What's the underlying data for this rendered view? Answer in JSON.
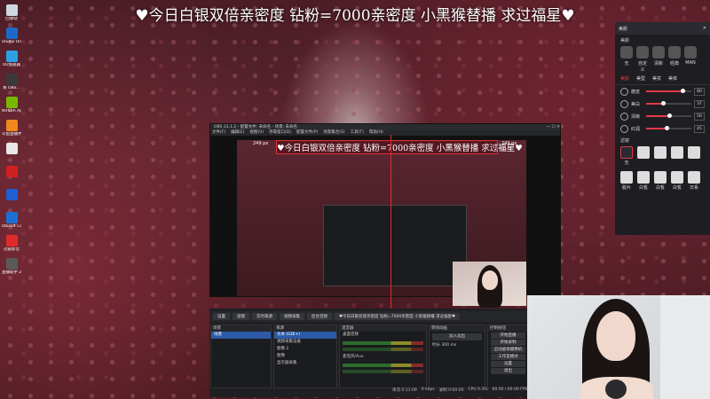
{
  "stream_banner": "♥今日白银双倍亲密度 钻粉=7000亲密度 小黑猴替播 求过福星♥",
  "desktop_icons": [
    {
      "label": "回收站",
      "color": "#cfd8e0"
    },
    {
      "label": "Studio One",
      "color": "#1b6ac9"
    },
    {
      "label": "UU加速器",
      "color": "#2ea0e6"
    },
    {
      "label": "易 OBS…",
      "color": "#3a3a3a"
    },
    {
      "label": "NVIDIA App",
      "color": "#76b900"
    },
    {
      "label": "斗鱼直播伴侣",
      "color": "#f08a1c"
    },
    {
      "label": "",
      "color": "#e8e8e8"
    },
    {
      "label": "",
      "color": "#d02020"
    },
    {
      "label": "",
      "color": "#1f5fd0"
    },
    {
      "label": "Ubisoft Connect",
      "color": "#1d6fd8"
    },
    {
      "label": "迅雷影音",
      "color": "#e02b2b"
    },
    {
      "label": "直播助手 2023(…",
      "color": "#5a5a5a"
    }
  ],
  "beauty_panel": {
    "window_title": "美颜",
    "preset_section": "美颜",
    "presets": [
      "无",
      "自定义",
      "清新",
      "经典",
      "MAN"
    ],
    "tabs": [
      "美颜",
      "美型",
      "美妆",
      "美体"
    ],
    "sliders": [
      {
        "label": "磨皮",
        "value": "80",
        "fraction": 0.8
      },
      {
        "label": "美白",
        "value": "37",
        "fraction": 0.37
      },
      {
        "label": "清晰",
        "value": "50",
        "fraction": 0.5
      },
      {
        "label": "红润",
        "value": "45",
        "fraction": 0.45
      }
    ],
    "filter_section": "滤镜",
    "filters": [
      "无",
      "",
      "",
      "",
      "",
      "胶片",
      "白皙",
      "白皙",
      "白皙",
      "日系"
    ]
  },
  "obs": {
    "window_title": "OBS 31.1.2 - 配置文件: 未命名 - 场景: 未命名",
    "menu": [
      "文件(F)",
      "编辑(E)",
      "视图(V)",
      "停靠窗口(D)",
      "配置文件(P)",
      "场景集合(S)",
      "工具(T)",
      "帮助(H)"
    ],
    "res_label_left": "249 px",
    "res_label_right": "249 px",
    "toolbar_tabs": [
      "设置",
      "滤镜",
      "实时来源",
      "视频采集",
      "后台音频",
      "♥今日白银双倍亲密度 钻粉=7000亲密度 小黑猴替播 求过福星♥"
    ],
    "scenes_header": "场景",
    "scenes": [
      "场景"
    ],
    "sources_header": "来源",
    "sources": [
      "文本 (GDI+)",
      "视频采集设备",
      "图像 2",
      "图像",
      "显示器采集"
    ],
    "mixer_header": "混音器",
    "mixer_channels": [
      "桌面音频",
      "麦克风/Aux"
    ],
    "transitions_header": "转场动画",
    "transition_value": "淡入淡出",
    "duration_label": "时长",
    "duration_value": "300 ms",
    "controls_header": "控制按钮",
    "controls": [
      "开始直播",
      "开始录制",
      "启动虚拟摄像机",
      "工作室模式",
      "设置",
      "退出"
    ],
    "status": [
      "串流 0:11:09",
      "0 kbps",
      "录制 0:00:00",
      "CPU 0.3%",
      "60.00 / 60.00 FPS"
    ]
  },
  "colors": {
    "accent_red": "#e02b2b",
    "obs_bg": "#222326",
    "selection_blue": "#2d5aa8"
  }
}
